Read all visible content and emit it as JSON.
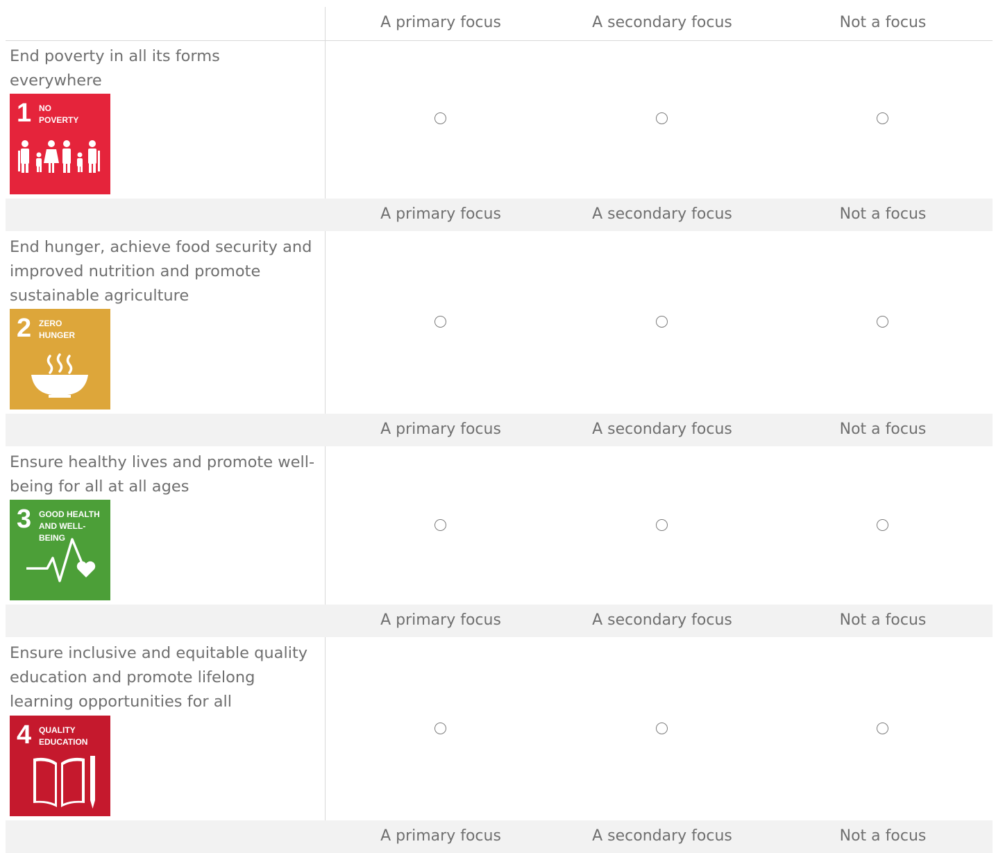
{
  "columns": [
    "A primary focus",
    "A secondary focus",
    "Not a focus"
  ],
  "rows": [
    {
      "statement": "End poverty in all its forms everywhere",
      "icon": {
        "number": "1",
        "line1": "NO",
        "line2": "POVERTY",
        "color": "#E5243B",
        "glyph": "family-icon"
      }
    },
    {
      "statement": "End hunger, achieve food security and improved nutrition and promote sustainable agriculture",
      "icon": {
        "number": "2",
        "line1": "ZERO",
        "line2": "HUNGER",
        "color": "#DDA63A",
        "glyph": "bowl-icon"
      }
    },
    {
      "statement": "Ensure healthy lives and promote well-being for all at all ages",
      "icon": {
        "number": "3",
        "line1": "GOOD HEALTH",
        "line2": "AND WELL-BEING",
        "color": "#4C9F38",
        "glyph": "heartbeat-icon"
      }
    },
    {
      "statement": "Ensure inclusive and equitable quality education and promote lifelong learning opportunities for all",
      "icon": {
        "number": "4",
        "line1": "QUALITY",
        "line2": "EDUCATION",
        "color": "#C5192D",
        "glyph": "book-pencil-icon"
      }
    }
  ],
  "colors": {
    "header_band": "#f2f2f2",
    "divider": "#d8d8d8",
    "text": "#6f6f6f"
  }
}
